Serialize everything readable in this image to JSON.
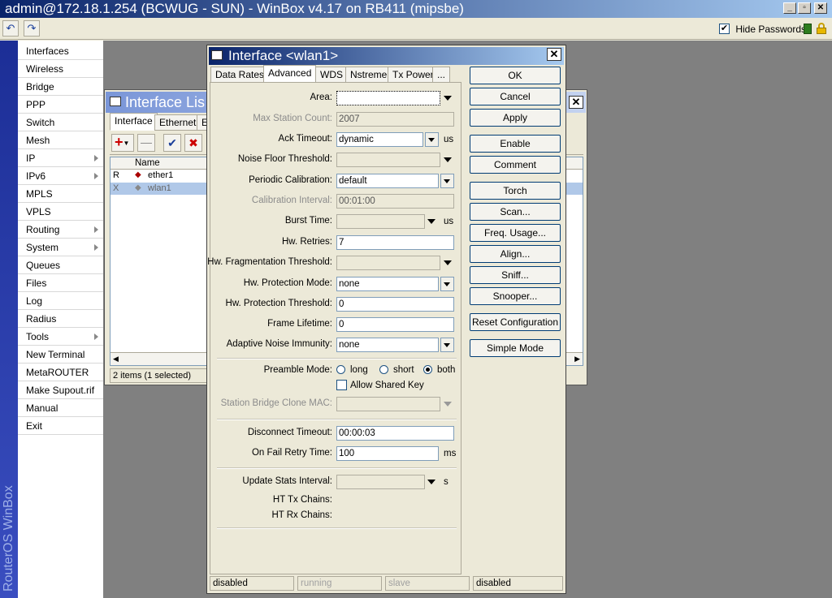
{
  "app": {
    "title": "admin@172.18.1.254 (BCWUG - SUN) - WinBox v4.17 on RB411 (mipsbe)",
    "hide_passwords_label": "Hide Passwords",
    "hide_passwords_checked": true,
    "vertical_brand": "RouterOS WinBox"
  },
  "sidebar": {
    "items": [
      {
        "label": "Interfaces",
        "submenu": false
      },
      {
        "label": "Wireless",
        "submenu": false
      },
      {
        "label": "Bridge",
        "submenu": false
      },
      {
        "label": "PPP",
        "submenu": false
      },
      {
        "label": "Switch",
        "submenu": false
      },
      {
        "label": "Mesh",
        "submenu": false
      },
      {
        "label": "IP",
        "submenu": true
      },
      {
        "label": "IPv6",
        "submenu": true
      },
      {
        "label": "MPLS",
        "submenu": false
      },
      {
        "label": "VPLS",
        "submenu": false
      },
      {
        "label": "Routing",
        "submenu": true
      },
      {
        "label": "System",
        "submenu": true
      },
      {
        "label": "Queues",
        "submenu": false
      },
      {
        "label": "Files",
        "submenu": false
      },
      {
        "label": "Log",
        "submenu": false
      },
      {
        "label": "Radius",
        "submenu": false
      },
      {
        "label": "Tools",
        "submenu": true
      },
      {
        "label": "New Terminal",
        "submenu": false
      },
      {
        "label": "MetaROUTER",
        "submenu": false
      },
      {
        "label": "Make Supout.rif",
        "submenu": false
      },
      {
        "label": "Manual",
        "submenu": false
      },
      {
        "label": "Exit",
        "submenu": false
      }
    ]
  },
  "interface_list": {
    "title": "Interface Lis",
    "tabs": [
      "Interface",
      "Ethernet",
      "E"
    ],
    "column_name": "Name",
    "rows": [
      {
        "flag": "R",
        "name": "ether1"
      },
      {
        "flag": "X",
        "name": "wlan1"
      }
    ],
    "status": "2 items (1 selected)"
  },
  "interface_window": {
    "title": "Interface <wlan1>",
    "tabs": [
      "Data Rates",
      "Advanced",
      "WDS",
      "Nstreme",
      "Tx Power",
      "..."
    ],
    "active_tab": "Advanced",
    "fields": {
      "area": {
        "label": "Area:",
        "value": ""
      },
      "max_station_count": {
        "label": "Max Station Count:",
        "value": "2007"
      },
      "ack_timeout": {
        "label": "Ack Timeout:",
        "value": "dynamic",
        "unit": "us"
      },
      "noise_floor_threshold": {
        "label": "Noise Floor Threshold:",
        "value": ""
      },
      "periodic_calibration": {
        "label": "Periodic Calibration:",
        "value": "default"
      },
      "calibration_interval": {
        "label": "Calibration Interval:",
        "value": "00:01:00"
      },
      "burst_time": {
        "label": "Burst Time:",
        "value": "",
        "unit": "us"
      },
      "hw_retries": {
        "label": "Hw. Retries:",
        "value": "7"
      },
      "hw_fragmentation_threshold": {
        "label": "Hw. Fragmentation Threshold:",
        "value": ""
      },
      "hw_protection_mode": {
        "label": "Hw. Protection Mode:",
        "value": "none"
      },
      "hw_protection_threshold": {
        "label": "Hw. Protection Threshold:",
        "value": "0"
      },
      "frame_lifetime": {
        "label": "Frame Lifetime:",
        "value": "0"
      },
      "adaptive_noise_immunity": {
        "label": "Adaptive Noise Immunity:",
        "value": "none"
      },
      "preamble_mode": {
        "label": "Preamble Mode:",
        "options": [
          "long",
          "short",
          "both"
        ],
        "selected": "both"
      },
      "allow_shared_key": {
        "label": "Allow Shared Key",
        "checked": false
      },
      "station_bridge_clone_mac": {
        "label": "Station Bridge Clone MAC:",
        "value": ""
      },
      "disconnect_timeout": {
        "label": "Disconnect Timeout:",
        "value": "00:00:03"
      },
      "on_fail_retry_time": {
        "label": "On Fail Retry Time:",
        "value": "100",
        "unit": "ms"
      },
      "update_stats_interval": {
        "label": "Update Stats Interval:",
        "value": "",
        "unit": "s"
      },
      "ht_tx_chains": {
        "label": "HT Tx Chains:"
      },
      "ht_rx_chains": {
        "label": "HT Rx Chains:"
      }
    },
    "buttons": [
      "OK",
      "Cancel",
      "Apply",
      "Enable",
      "Comment",
      "Torch",
      "Scan...",
      "Freq. Usage...",
      "Align...",
      "Sniff...",
      "Snooper...",
      "Reset Configuration",
      "Simple Mode"
    ],
    "status": [
      "disabled",
      "running",
      "slave",
      "disabled"
    ]
  }
}
